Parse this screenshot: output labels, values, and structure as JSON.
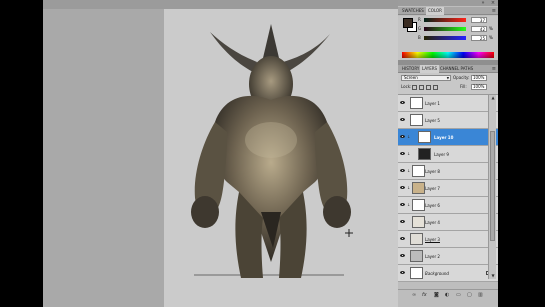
{
  "tabs": {
    "color": [
      "SWATCHES",
      "COLOR"
    ],
    "layers": [
      "HISTORY",
      "LAYERS",
      "CHANNEL PATHS"
    ]
  },
  "color": {
    "foreground": "#3a2c22",
    "background": "#ffffff",
    "channels": [
      {
        "label": "R",
        "value": "37",
        "unit": ""
      },
      {
        "label": "G",
        "value": "42",
        "unit": "%"
      },
      {
        "label": "B",
        "value": "25",
        "unit": "%"
      }
    ]
  },
  "layers_panel": {
    "blend_mode": "Screen",
    "opacity_label": "Opacity:",
    "opacity_value": "100%",
    "lock_label": "Lock:",
    "fill_label": "Fill:",
    "fill_value": "100%"
  },
  "layers": [
    {
      "name": "Layer 1",
      "selected": false,
      "mask": false,
      "style": ""
    },
    {
      "name": "Layer 5",
      "selected": false,
      "mask": false,
      "style": ""
    },
    {
      "name": "Layer 10",
      "selected": true,
      "mask": true,
      "style": ""
    },
    {
      "name": "Layer 9",
      "selected": false,
      "mask": true,
      "style": ""
    },
    {
      "name": "Layer 8",
      "selected": false,
      "mask": false,
      "style": ""
    },
    {
      "name": "Layer 7",
      "selected": false,
      "mask": false,
      "style": ""
    },
    {
      "name": "Layer 6",
      "selected": false,
      "mask": false,
      "style": ""
    },
    {
      "name": "Layer 4",
      "selected": false,
      "mask": false,
      "style": ""
    },
    {
      "name": "Layer 3",
      "selected": false,
      "mask": false,
      "style": "under"
    },
    {
      "name": "Layer 2",
      "selected": false,
      "mask": false,
      "style": ""
    },
    {
      "name": "Background",
      "selected": false,
      "mask": false,
      "style": "italic"
    }
  ],
  "footer_icons": [
    "link-icon",
    "fx-icon",
    "mask-icon",
    "adjustment-icon",
    "group-icon",
    "new-layer-icon",
    "trash-icon"
  ]
}
